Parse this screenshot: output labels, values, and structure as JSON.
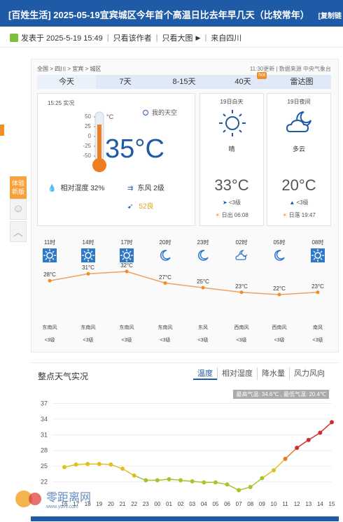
{
  "title_bar": {
    "title": "[百姓生活] 2025-05-19宜宾城区今年首个高温日比去年早几天（比较常年）",
    "copy_label": "[复制链"
  },
  "meta": {
    "posted": "发表于 2025-5-19 15:49",
    "only_author": "只看该作者",
    "only_images": "只看大图",
    "from": "来自四川"
  },
  "float_menu": {
    "new_label": "体验新版"
  },
  "card": {
    "breadcrumb": "全国 > 四川 > 宜宾 > 城区",
    "source": "11:30更新 | 数据来源 中央气象台",
    "tabs": [
      {
        "label": "今天"
      },
      {
        "label": "7天"
      },
      {
        "label": "8-15天"
      },
      {
        "label": "40天",
        "badge": "hot"
      },
      {
        "label": "雷达图"
      }
    ],
    "now": {
      "time": "15:25 实况",
      "my_sky": "我的天空",
      "scale": [
        "50",
        "25",
        "0",
        "-25",
        "-50"
      ],
      "unit": "°C",
      "temp": "35°C",
      "humidity": "相对湿度  32%",
      "wind": "东风  2级",
      "aqi": "52良"
    },
    "day": {
      "title": "19日白天",
      "desc": "晴",
      "temp": "33°C",
      "wind": "<3级",
      "sun": "日出 06:08"
    },
    "night": {
      "title": "19日夜间",
      "desc": "多云",
      "temp": "20°C",
      "wind": "<3级",
      "sun": "日落 19:47"
    },
    "hourly": [
      {
        "time": "11时",
        "temp": "28°C",
        "wind": "东南风",
        "level": "<3级",
        "icon": "sun"
      },
      {
        "time": "14时",
        "temp": "31°C",
        "wind": "东南风",
        "level": "<3级",
        "icon": "sun"
      },
      {
        "time": "17时",
        "temp": "32°C",
        "wind": "东南风",
        "level": "<3级",
        "icon": "sun"
      },
      {
        "time": "20时",
        "temp": "27°C",
        "wind": "东南风",
        "level": "<3级",
        "icon": "moon"
      },
      {
        "time": "23时",
        "temp": "25°C",
        "wind": "东风",
        "level": "<3级",
        "icon": "moon"
      },
      {
        "time": "02时",
        "temp": "23°C",
        "wind": "西南风",
        "level": "<3级",
        "icon": "cloud-moon"
      },
      {
        "time": "05时",
        "temp": "22°C",
        "wind": "西南风",
        "level": "<3级",
        "icon": "moon"
      },
      {
        "time": "08时",
        "temp": "23°C",
        "wind": "南风",
        "level": "<3级",
        "icon": "sun"
      }
    ]
  },
  "section2": {
    "title": "整点天气实况",
    "tabs": [
      "温度",
      "相对湿度",
      "降水量",
      "风力风向"
    ],
    "legend": "最高气温: 34.6℃ , 最低气温: 20.4℃"
  },
  "watermark": {
    "text": "零距离网",
    "url": "www.ybvv.com"
  },
  "chart_data": {
    "type": "line",
    "title": "",
    "xlabel": "",
    "ylabel": "",
    "y_ticks": [
      22,
      25,
      28,
      31,
      34,
      37
    ],
    "ylim": [
      19,
      38
    ],
    "x": [
      "16",
      "17",
      "18",
      "19",
      "20",
      "21",
      "22",
      "23",
      "00",
      "01",
      "02",
      "03",
      "04",
      "05",
      "06",
      "07",
      "08",
      "09",
      "10",
      "11",
      "12",
      "13",
      "14",
      "15"
    ],
    "series": [
      {
        "values": [
          24.8,
          25.3,
          25.4,
          25.4,
          25.3,
          24.5,
          23.2,
          22.3,
          22.3,
          22.5,
          22.3,
          22.1,
          21.9,
          21.9,
          21.5,
          20.4,
          21.0,
          22.7,
          24.2,
          26.4,
          28.5,
          30.0,
          31.4,
          33.4
        ]
      }
    ]
  }
}
